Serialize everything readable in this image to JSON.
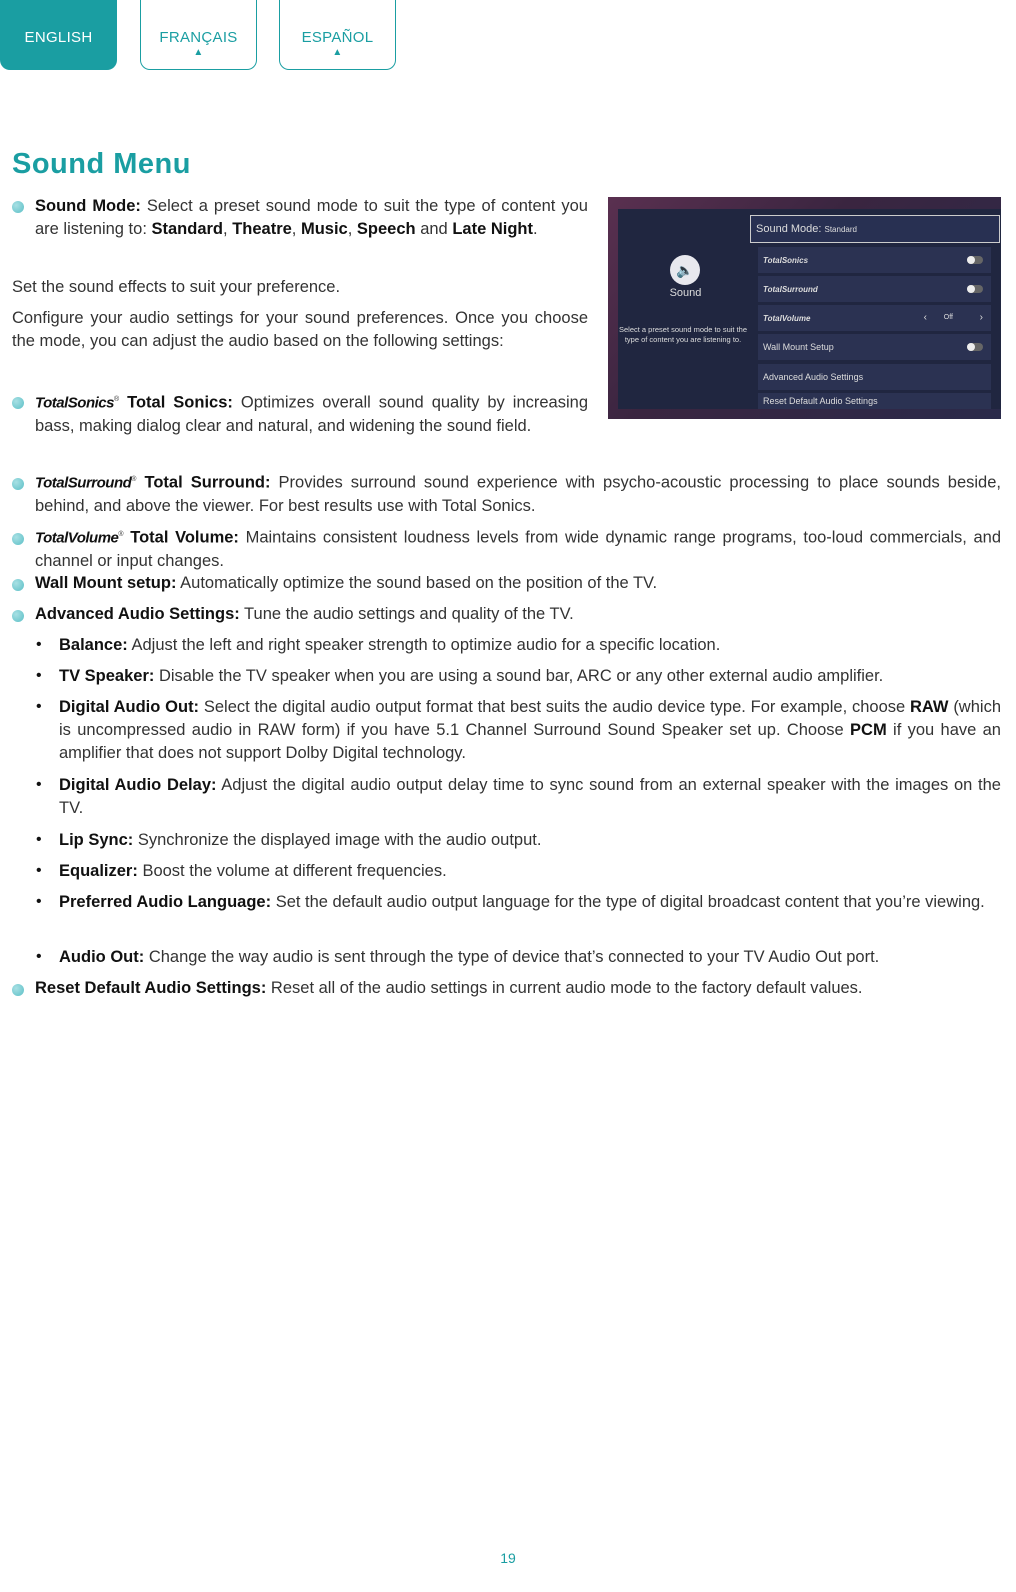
{
  "tabs": [
    {
      "label": "ENGLISH",
      "active": true
    },
    {
      "label": "FRANÇAIS",
      "active": false,
      "marker": "▲"
    },
    {
      "label": "ESPAÑOL",
      "active": false,
      "marker": "▲"
    }
  ],
  "title": "Sound Menu",
  "sound_mode": {
    "label": "Sound Mode:",
    "text": "Select a preset sound mode to suit the type of content you are listening to:",
    "modes": [
      "Standard",
      "Theatre",
      "Music",
      "Speech",
      "Late Night"
    ],
    "and": "and",
    "sep": ","
  },
  "intro1": "Set the sound effects to suit your preference.",
  "intro2": "Configure your audio settings for your sound preferences. Once you choose the mode, you can adjust the audio based on the following settings:",
  "items": [
    {
      "brand": "TotalSonics",
      "label": "Total Sonics:",
      "text": "Optimizes overall sound quality by increasing bass, making dialog clear and natural, and widening the sound field."
    },
    {
      "brand": "TotalSurround",
      "label": "Total Surround:",
      "text": "Provides surround sound experience with psycho-acoustic processing to place sounds beside, behind, and above the viewer. For best results use with Total Sonics."
    },
    {
      "brand": "TotalVolume",
      "label": "Total Volume:",
      "text": "Maintains consistent loudness levels from wide dynamic range programs, too-loud commercials, and channel or input changes."
    },
    {
      "label": "Wall Mount setup:",
      "text": "Automatically optimize the sound based on the position of the TV."
    },
    {
      "label": "Advanced Audio Settings:",
      "text": "Tune the audio settings and quality of the TV."
    }
  ],
  "sub_items": [
    {
      "label": "Balance:",
      "text": "Adjust the left and right speaker strength to optimize audio for a specific location."
    },
    {
      "label": "TV Speaker:",
      "text": "Disable the TV speaker when you are using a sound bar, ARC or any other external audio amplifier."
    },
    {
      "label": "Digital Audio Out:",
      "text1": "Select the digital audio output format that best suits the audio device type. For example, choose",
      "raw": "RAW",
      "text2": "(which is uncompressed audio in RAW form) if you have 5.1 Channel Surround Sound Speaker set up. Choose",
      "pcm": "PCM",
      "text3": "if you have an amplifier that does not support Dolby Digital technology."
    },
    {
      "label": "Digital Audio Delay:",
      "text": "Adjust the digital audio output delay time to sync sound from an external speaker with the images on the TV."
    },
    {
      "label": "Lip Sync:",
      "text": "Synchronize the displayed image with the audio output."
    },
    {
      "label": "Equalizer:",
      "text": "Boost the volume at different frequencies."
    },
    {
      "label": "Preferred Audio Language:",
      "text": "Set the default audio output language for the type of digital broadcast content that you’re viewing."
    },
    {
      "label": "Audio Out:",
      "text": "Change the way audio is sent through the type of device that’s connected to your TV Audio Out port."
    }
  ],
  "reset": {
    "label": "Reset Default Audio Settings:",
    "text": "Reset all of the audio settings in current audio mode to the factory default values."
  },
  "tv_screen": {
    "panel_title": "Sound",
    "panel_desc": "Select a preset sound mode to suit the type of content you are listening to.",
    "sound_mode_label": "Sound Mode:",
    "sound_mode_value": "Standard",
    "rows": [
      {
        "label": "TotalSonics",
        "toggle": "off"
      },
      {
        "label": "TotalSurround",
        "toggle": "off"
      },
      {
        "label": "TotalVolume",
        "value": "Off",
        "prev": "‹",
        "next": "›"
      },
      {
        "label": "Wall Mount Setup",
        "toggle": "off"
      },
      {
        "label": "Advanced Audio Settings"
      },
      {
        "label": "Reset Default Audio Settings"
      }
    ]
  },
  "page_number": "19",
  "colors": {
    "accent": "#1a9ea2",
    "bullet": "#5bbfc6"
  }
}
